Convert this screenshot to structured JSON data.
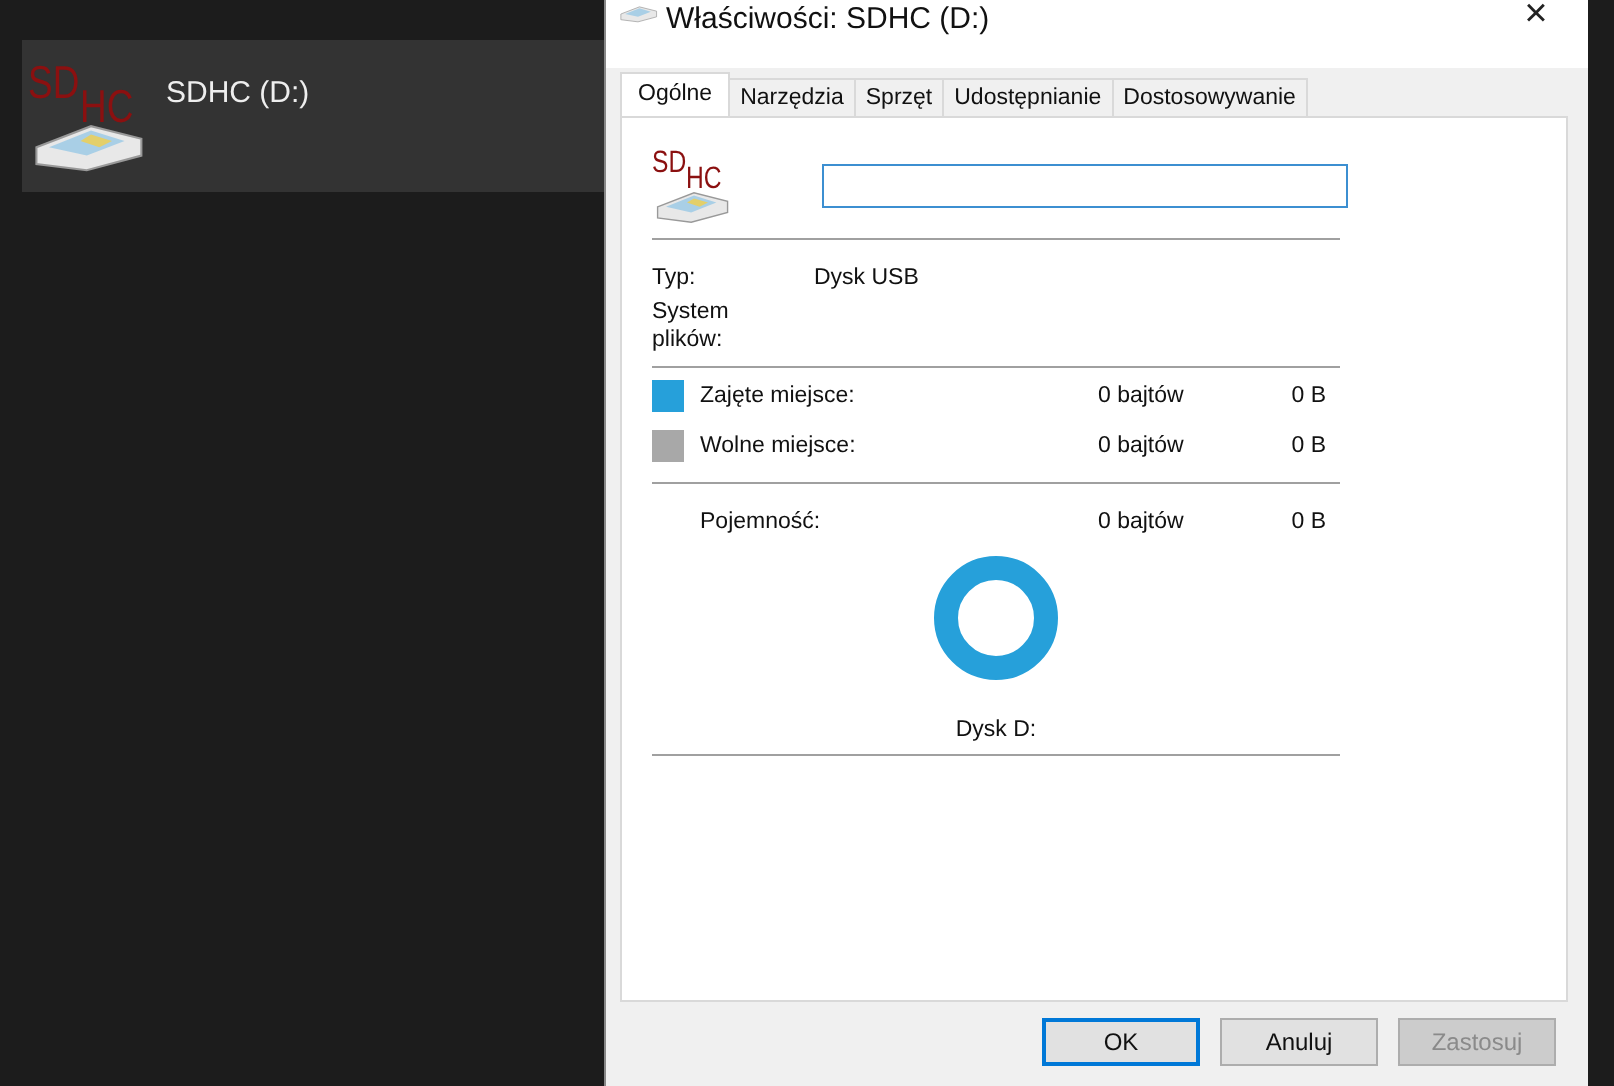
{
  "explorer_item": {
    "logo": {
      "top": "SD",
      "sub": "HC"
    },
    "label": "SDHC (D:)",
    "selected": true
  },
  "dialog": {
    "title": "Właściwości: SDHC (D:)",
    "close": "×",
    "tabs": [
      {
        "label": "Ogólne",
        "selected": true
      },
      {
        "label": "Narzędzia",
        "selected": false
      },
      {
        "label": "Sprzęt",
        "selected": false
      },
      {
        "label": "Udostępnianie",
        "selected": false
      },
      {
        "label": "Dostosowywanie",
        "selected": false
      }
    ],
    "general": {
      "logo": {
        "top": "SD",
        "sub": "HC"
      },
      "name_field": {
        "kind": "text"
      },
      "info": [
        {
          "label": "Typ:",
          "value": "Dysk USB"
        },
        {
          "label": "System plików:"
        }
      ],
      "space": [
        {
          "label": "Zajęte miejsce:",
          "bytes": "0 bajtów",
          "size": "0 B",
          "color": "#26a0da"
        },
        {
          "label": "Wolne miejsce:",
          "bytes": "0 bajtów",
          "size": "0 B",
          "color": "#a8a8a8"
        }
      ],
      "capacity": {
        "label": "Pojemność:",
        "bytes": "0 bajtów",
        "size": "0 B"
      },
      "drive_caption": "Dysk D:"
    },
    "buttons": [
      {
        "label": "OK",
        "kind": "default"
      },
      {
        "label": "Anuluj",
        "kind": "normal"
      },
      {
        "label": "Zastosuj",
        "kind": "disabled"
      }
    ]
  }
}
